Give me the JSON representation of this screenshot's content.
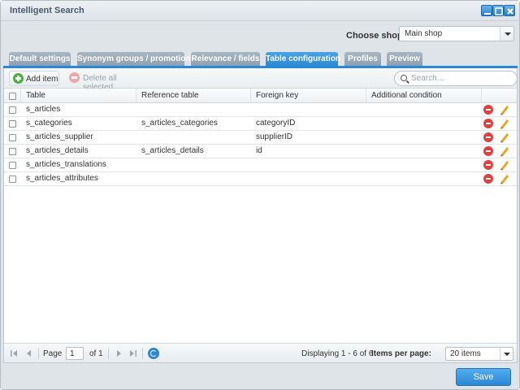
{
  "window": {
    "title": "Intelligent Search",
    "controls": [
      "minimize-icon",
      "maximize-icon",
      "close-icon"
    ]
  },
  "shop": {
    "label": "Choose shop:",
    "selected": "Main shop"
  },
  "tabs": [
    {
      "label": "Default settings",
      "active": false
    },
    {
      "label": "Synonym groups / promotions",
      "active": false
    },
    {
      "label": "Relevance / fields",
      "active": false
    },
    {
      "label": "Table configuration",
      "active": true
    },
    {
      "label": "Profiles",
      "active": false
    },
    {
      "label": "Preview",
      "active": false
    }
  ],
  "toolbar": {
    "add_label": "Add item",
    "delete_label": "Delete all selected",
    "search_placeholder": "Search..."
  },
  "grid": {
    "columns": [
      "Table",
      "Reference table",
      "Foreign key",
      "Additional condition"
    ],
    "rows": [
      {
        "table": "s_articles",
        "reference": "",
        "foreign_key": "",
        "condition": ""
      },
      {
        "table": "s_categories",
        "reference": "s_articles_categories",
        "foreign_key": "categoryID",
        "condition": ""
      },
      {
        "table": "s_articles_supplier",
        "reference": "",
        "foreign_key": "supplierID",
        "condition": ""
      },
      {
        "table": "s_articles_details",
        "reference": "s_articles_details",
        "foreign_key": "id",
        "condition": ""
      },
      {
        "table": "s_articles_translations",
        "reference": "",
        "foreign_key": "",
        "condition": ""
      },
      {
        "table": "s_articles_attributes",
        "reference": "",
        "foreign_key": "",
        "condition": ""
      }
    ]
  },
  "pager": {
    "page_label": "Page",
    "page_value": "1",
    "of_label": "of 1",
    "displaying": "Displaying 1 - 6 of 6",
    "items_per_page_label": "Items per page:",
    "items_per_page_value": "20 items"
  },
  "footer": {
    "save_label": "Save"
  },
  "colors": {
    "accent": "#2a88d4",
    "tab_inactive": "#9aabb8",
    "delete_red": "#e23f3f",
    "add_green": "#4cae3f",
    "edit_orange": "#f0a020"
  }
}
